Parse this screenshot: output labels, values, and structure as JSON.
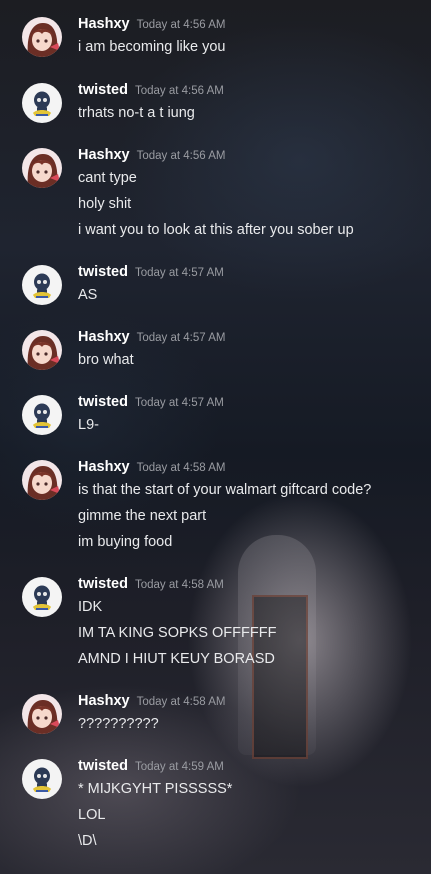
{
  "colors": {
    "username": "#ffffff",
    "timestamp": "#9a9ca2",
    "text": "#e9eaec"
  },
  "messages": [
    {
      "author": "Hashxy",
      "avatar": "anime-girl-avatar",
      "time": "Today at 4:56 AM",
      "lines": [
        "i am becoming like you"
      ]
    },
    {
      "author": "twisted",
      "avatar": "skull-avatar",
      "time": "Today at 4:56 AM",
      "lines": [
        "trhats no-t a t iung"
      ]
    },
    {
      "author": "Hashxy",
      "avatar": "anime-girl-avatar",
      "time": "Today at 4:56 AM",
      "lines": [
        "cant type",
        "holy shit",
        "i want you to look at this after you sober up"
      ]
    },
    {
      "author": "twisted",
      "avatar": "skull-avatar",
      "time": "Today at 4:57 AM",
      "lines": [
        "AS"
      ]
    },
    {
      "author": "Hashxy",
      "avatar": "anime-girl-avatar",
      "time": "Today at 4:57 AM",
      "lines": [
        "bro what"
      ]
    },
    {
      "author": "twisted",
      "avatar": "skull-avatar",
      "time": "Today at 4:57 AM",
      "lines": [
        "L9-"
      ]
    },
    {
      "author": "Hashxy",
      "avatar": "anime-girl-avatar",
      "time": "Today at 4:58 AM",
      "lines": [
        "is that the start of your walmart giftcard code?",
        "gimme the next part",
        "im buying food"
      ]
    },
    {
      "author": "twisted",
      "avatar": "skull-avatar",
      "time": "Today at 4:58 AM",
      "lines": [
        "IDK",
        "IM TA KING SOPKS OFFFFFF",
        "AMND I HIUT KEUY  BORASD"
      ]
    },
    {
      "author": "Hashxy",
      "avatar": "anime-girl-avatar",
      "time": "Today at 4:58 AM",
      "lines": [
        "??????????"
      ]
    },
    {
      "author": "twisted",
      "avatar": "skull-avatar",
      "time": "Today at 4:59 AM",
      "lines": [
        "* MIJKGYHT PISSSSS*",
        "LOL",
        "\\D\\"
      ]
    }
  ]
}
